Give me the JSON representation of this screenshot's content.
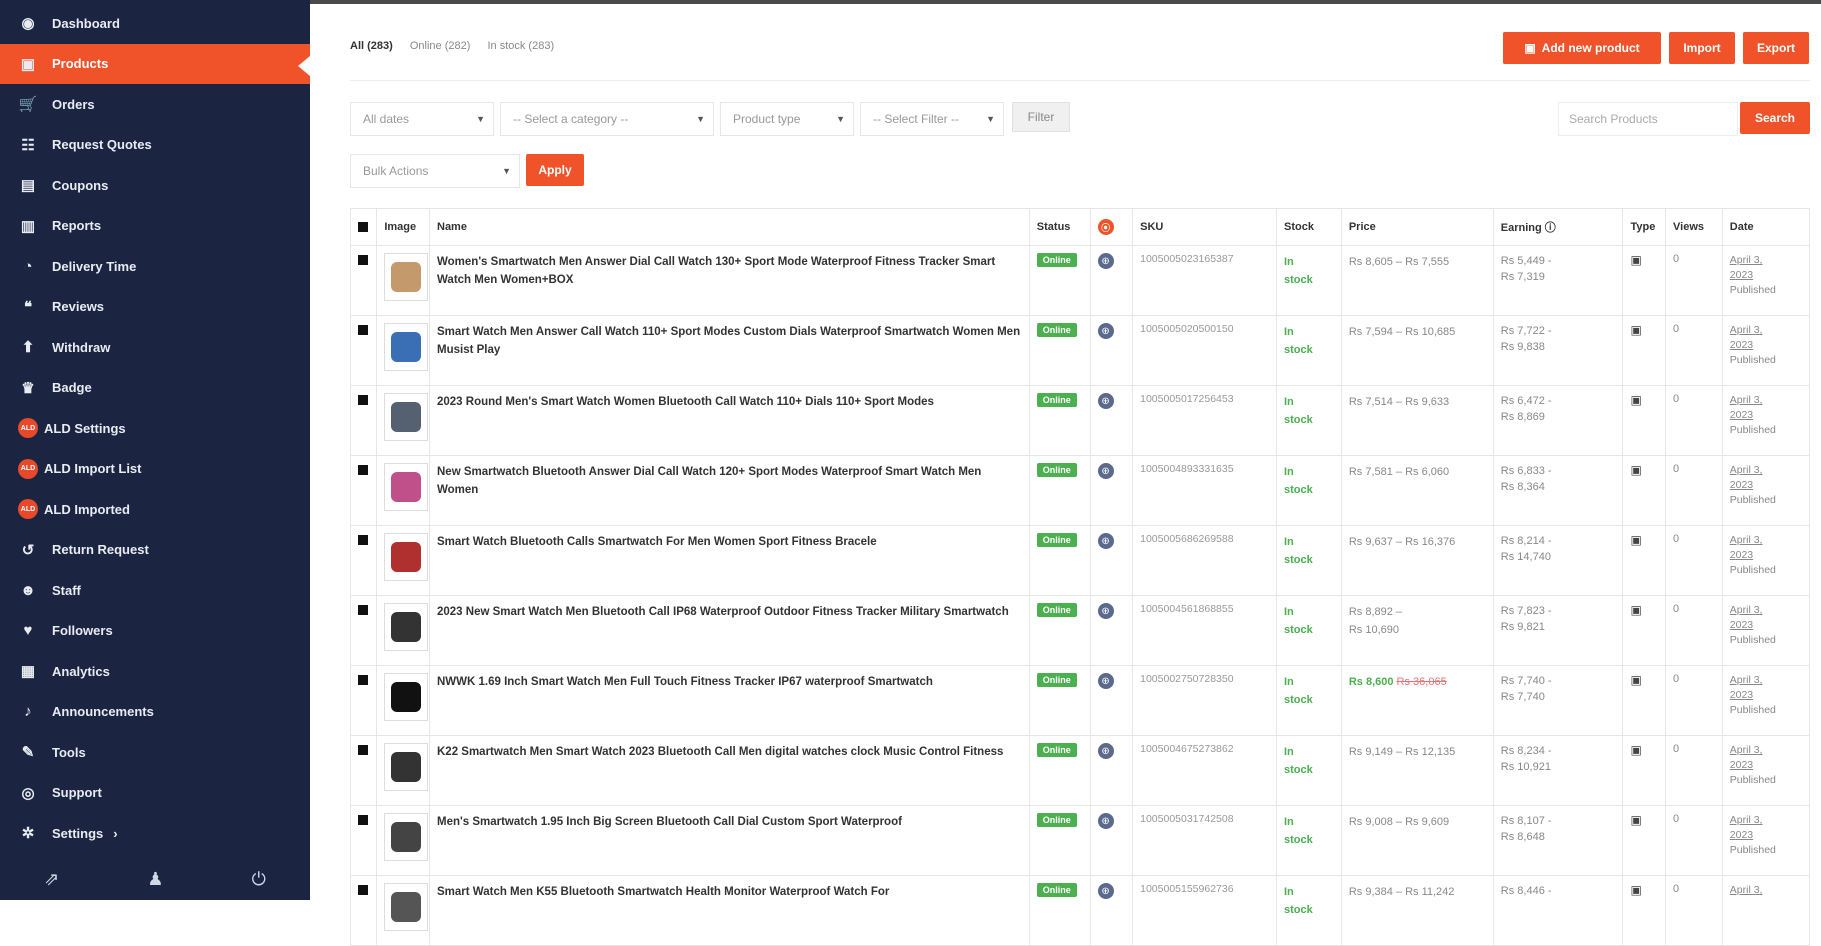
{
  "sidebar": {
    "items": [
      {
        "label": "Dashboard",
        "icon": "dashboard-icon",
        "glyph": "◉"
      },
      {
        "label": "Products",
        "icon": "products-icon",
        "glyph": "▣",
        "active": true
      },
      {
        "label": "Orders",
        "icon": "cart-icon",
        "glyph": "🛒"
      },
      {
        "label": "Request Quotes",
        "icon": "quotes-icon",
        "glyph": "☷"
      },
      {
        "label": "Coupons",
        "icon": "coupon-icon",
        "glyph": "▤"
      },
      {
        "label": "Reports",
        "icon": "chart-icon",
        "glyph": "▥"
      },
      {
        "label": "Delivery Time",
        "icon": "clock-icon",
        "glyph": "◔"
      },
      {
        "label": "Reviews",
        "icon": "reviews-icon",
        "glyph": "❝"
      },
      {
        "label": "Withdraw",
        "icon": "withdraw-icon",
        "glyph": "⬆"
      },
      {
        "label": "Badge",
        "icon": "badge-icon",
        "glyph": "♛"
      },
      {
        "label": "ALD Settings",
        "icon": "ald-icon",
        "glyph": "ALD",
        "ald": true
      },
      {
        "label": "ALD Import List",
        "icon": "ald-icon",
        "glyph": "ALD",
        "ald": true
      },
      {
        "label": "ALD Imported",
        "icon": "ald-icon",
        "glyph": "ALD",
        "ald": true
      },
      {
        "label": "Return Request",
        "icon": "return-icon",
        "glyph": "↺"
      },
      {
        "label": "Staff",
        "icon": "staff-icon",
        "glyph": "☻"
      },
      {
        "label": "Followers",
        "icon": "heart-icon",
        "glyph": "♥"
      },
      {
        "label": "Analytics",
        "icon": "analytics-icon",
        "glyph": "▦"
      },
      {
        "label": "Announcements",
        "icon": "bell-icon",
        "glyph": "♪"
      },
      {
        "label": "Tools",
        "icon": "wrench-icon",
        "glyph": "✎"
      },
      {
        "label": "Support",
        "icon": "support-icon",
        "glyph": "◎"
      },
      {
        "label": "Settings",
        "icon": "gear-icon",
        "glyph": "✲",
        "chevron": "›"
      }
    ],
    "footer": [
      {
        "icon": "external-link-icon",
        "glyph": "⇗"
      },
      {
        "icon": "user-icon",
        "glyph": "♟"
      },
      {
        "icon": "power-icon",
        "glyph": "⏻"
      }
    ]
  },
  "tabs": {
    "all": "All (283)",
    "online": "Online (282)",
    "instock": "In stock (283)"
  },
  "actions": {
    "add": "Add new product",
    "import": "Import",
    "export": "Export",
    "add_icon": "▣"
  },
  "filters": {
    "dates": "All dates",
    "category": "-- Select a category --",
    "type": "Product type",
    "filter_select": "-- Select Filter --",
    "filter_btn": "Filter",
    "search_placeholder": "Search Products",
    "search_btn": "Search",
    "bulk": "Bulk Actions",
    "apply": "Apply"
  },
  "table": {
    "headers": {
      "image": "Image",
      "name": "Name",
      "status": "Status",
      "sku": "SKU",
      "stock": "Stock",
      "price": "Price",
      "earning": "Earning ⓘ",
      "type": "Type",
      "views": "Views",
      "date": "Date"
    },
    "rows": [
      {
        "name": "Women's Smartwatch Men Answer Dial Call Watch 130+ Sport Mode Waterproof Fitness Tracker Smart Watch Men Women+BOX",
        "status": "Online",
        "sku": "1005005023165387",
        "stock1": "In",
        "stock2": "stock",
        "price1": "Rs 8,605 – Rs 7,555",
        "price2": "",
        "earn1": "Rs 5,449 -",
        "earn2": "Rs 7,319",
        "views": "0",
        "date1": "April 3,",
        "date2": "2023",
        "date3": "Published",
        "color": "#c49a6c"
      },
      {
        "name": "Smart Watch Men Answer Call Watch 110+ Sport Modes Custom Dials Waterproof Smartwatch Women Men Musist Play",
        "status": "Online",
        "sku": "1005005020500150",
        "stock1": "In",
        "stock2": "stock",
        "price1": "Rs 7,594 – Rs 10,685",
        "price2": "",
        "earn1": "Rs 7,722 -",
        "earn2": "Rs 9,838",
        "views": "0",
        "date1": "April 3,",
        "date2": "2023",
        "date3": "Published",
        "color": "#3a6fb5"
      },
      {
        "name": "2023 Round Men's Smart Watch Women Bluetooth Call Watch 110+ Dials 110+ Sport Modes",
        "status": "Online",
        "sku": "1005005017256453",
        "stock1": "In",
        "stock2": "stock",
        "price1": "Rs 7,514 – Rs 9,633",
        "price2": "",
        "earn1": "Rs 6,472 -",
        "earn2": "Rs 8,869",
        "views": "0",
        "date1": "April 3,",
        "date2": "2023",
        "date3": "Published",
        "color": "#556070"
      },
      {
        "name": "New Smartwatch Bluetooth Answer Dial Call Watch 120+ Sport Modes Waterproof Smart Watch Men Women",
        "status": "Online",
        "sku": "1005004893331635",
        "stock1": "In",
        "stock2": "stock",
        "price1": "Rs 7,581 – Rs 6,060",
        "price2": "",
        "earn1": "Rs 6,833 -",
        "earn2": "Rs 8,364",
        "views": "0",
        "date1": "April 3,",
        "date2": "2023",
        "date3": "Published",
        "color": "#c0508a"
      },
      {
        "name": "Smart Watch Bluetooth Calls Smartwatch For Men Women Sport Fitness Bracele",
        "status": "Online",
        "sku": "1005005686269588",
        "stock1": "In",
        "stock2": "stock",
        "price1": "Rs 9,637 – Rs 16,376",
        "price2": "",
        "earn1": "Rs 8,214 -",
        "earn2": "Rs 14,740",
        "views": "0",
        "date1": "April 3,",
        "date2": "2023",
        "date3": "Published",
        "color": "#b03030"
      },
      {
        "name": "2023 New Smart Watch Men Bluetooth Call IP68 Waterproof Outdoor Fitness Tracker Military Smartwatch",
        "status": "Online",
        "sku": "1005004561868855",
        "stock1": "In",
        "stock2": "stock",
        "price1": "Rs 8,892 –",
        "price2": "Rs 10,690",
        "earn1": "Rs 7,823 -",
        "earn2": "Rs 9,821",
        "views": "0",
        "date1": "April 3,",
        "date2": "2023",
        "date3": "Published",
        "color": "#333"
      },
      {
        "name": "NWWK 1.69 Inch Smart Watch Men Full Touch Fitness Tracker IP67 waterproof Smartwatch",
        "status": "Online",
        "sku": "1005002750728350",
        "stock1": "In",
        "stock2": "stock",
        "price_sale": "Rs 8,600",
        "price_old": "Rs 36,065",
        "earn1": "Rs 7,740 -",
        "earn2": "Rs 7,740",
        "views": "0",
        "date1": "April 3,",
        "date2": "2023",
        "date3": "Published",
        "color": "#111"
      },
      {
        "name": "K22 Smartwatch Men Smart Watch 2023 Bluetooth Call Men digital watches clock Music Control Fitness",
        "status": "Online",
        "sku": "1005004675273862",
        "stock1": "In",
        "stock2": "stock",
        "price1": "Rs 9,149 – Rs 12,135",
        "price2": "",
        "earn1": "Rs 8,234 -",
        "earn2": "Rs 10,921",
        "views": "0",
        "date1": "April 3,",
        "date2": "2023",
        "date3": "Published",
        "color": "#333"
      },
      {
        "name": "Men's Smartwatch 1.95 Inch Big Screen Bluetooth Call Dial Custom Sport Waterproof",
        "status": "Online",
        "sku": "1005005031742508",
        "stock1": "In",
        "stock2": "stock",
        "price1": "Rs 9,008 – Rs 9,609",
        "price2": "",
        "earn1": "Rs 8,107 -",
        "earn2": "Rs 8,648",
        "views": "0",
        "date1": "April 3,",
        "date2": "2023",
        "date3": "Published",
        "color": "#444"
      },
      {
        "name": "Smart Watch Men K55 Bluetooth Smartwatch Health Monitor Waterproof Watch For",
        "status": "Online",
        "sku": "1005005155962736",
        "stock1": "In",
        "stock2": "stock",
        "price1": "Rs 9,384 – Rs 11,242",
        "price2": "",
        "earn1": "Rs 8,446 -",
        "earn2": "",
        "views": "0",
        "date1": "April 3,",
        "date2": "",
        "date3": "",
        "color": "#555"
      }
    ]
  }
}
